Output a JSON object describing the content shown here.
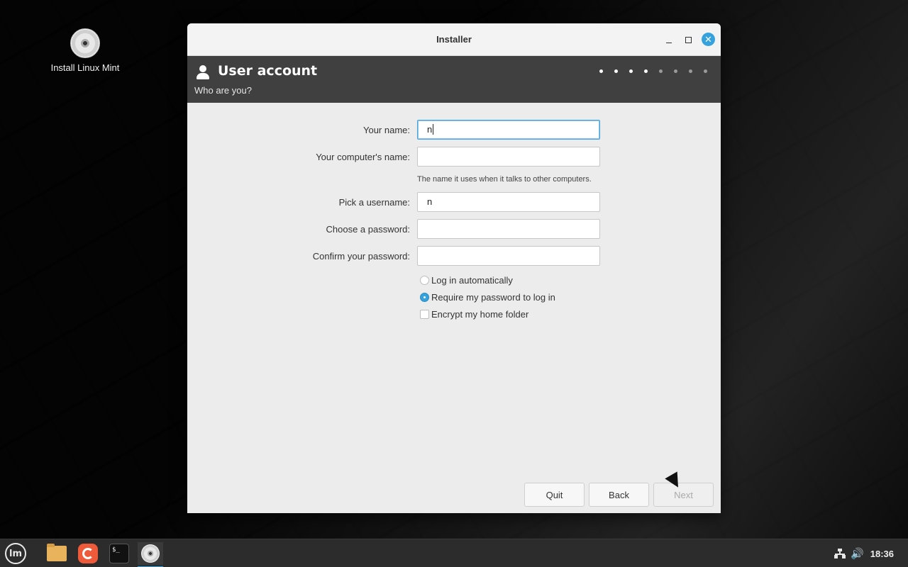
{
  "desktop": {
    "icon_label": "Install Linux Mint"
  },
  "window": {
    "title": "Installer",
    "close_glyph": "✕"
  },
  "header": {
    "title": "User account",
    "subtitle": "Who are you?",
    "steps_done": 4,
    "steps_total": 8
  },
  "form": {
    "your_name_label": "Your name:",
    "your_name_value": "n",
    "computer_name_label": "Your computer's name:",
    "computer_name_value": "",
    "computer_name_hint": "The name it uses when it talks to other computers.",
    "username_label": "Pick a username:",
    "username_value": "n",
    "password_label": "Choose a password:",
    "password_value": "",
    "confirm_label": "Confirm your password:",
    "confirm_value": ""
  },
  "options": {
    "auto_login": "Log in automatically",
    "require_password": "Require my password to log in",
    "encrypt_home": "Encrypt my home folder",
    "selected": "require_password",
    "encrypt_checked": false
  },
  "buttons": {
    "quit": "Quit",
    "back": "Back",
    "next": "Next"
  },
  "taskbar": {
    "menu_logo": "lm",
    "terminal_glyph": "$_",
    "volume_glyph": "🔊",
    "clock": "18:36"
  },
  "colors": {
    "accent": "#35a2dd",
    "header_bg": "#404040",
    "window_bg": "#ececec"
  }
}
